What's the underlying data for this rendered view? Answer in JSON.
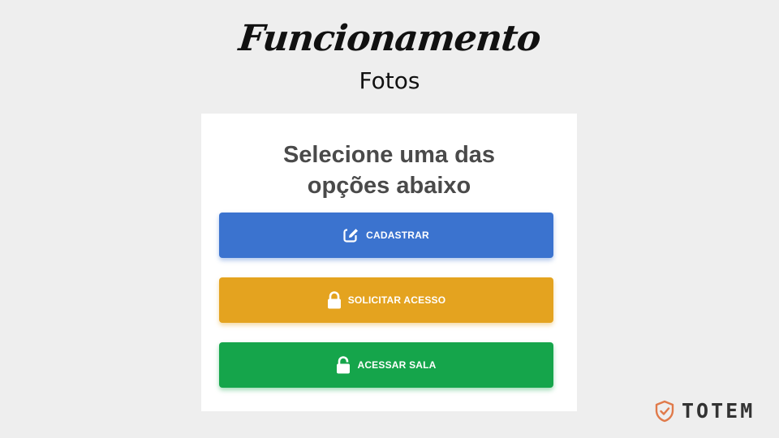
{
  "slide": {
    "title": "Funcionamento",
    "subtitle": "Fotos"
  },
  "card": {
    "heading_line1": "Selecione uma das",
    "heading_line2": "opções abaixo"
  },
  "buttons": [
    {
      "label": "CADASTRAR",
      "icon": "edit-icon",
      "color": "#3b73cf"
    },
    {
      "label": "SOLICITAR ACESSO",
      "icon": "lock-icon",
      "color": "#e4a31f"
    },
    {
      "label": "ACESSAR SALA",
      "icon": "unlock-icon",
      "color": "#15a54b"
    }
  ],
  "brand": {
    "name": "TOTEM",
    "icon": "shield-check-icon",
    "accent": "#e07a4a"
  }
}
